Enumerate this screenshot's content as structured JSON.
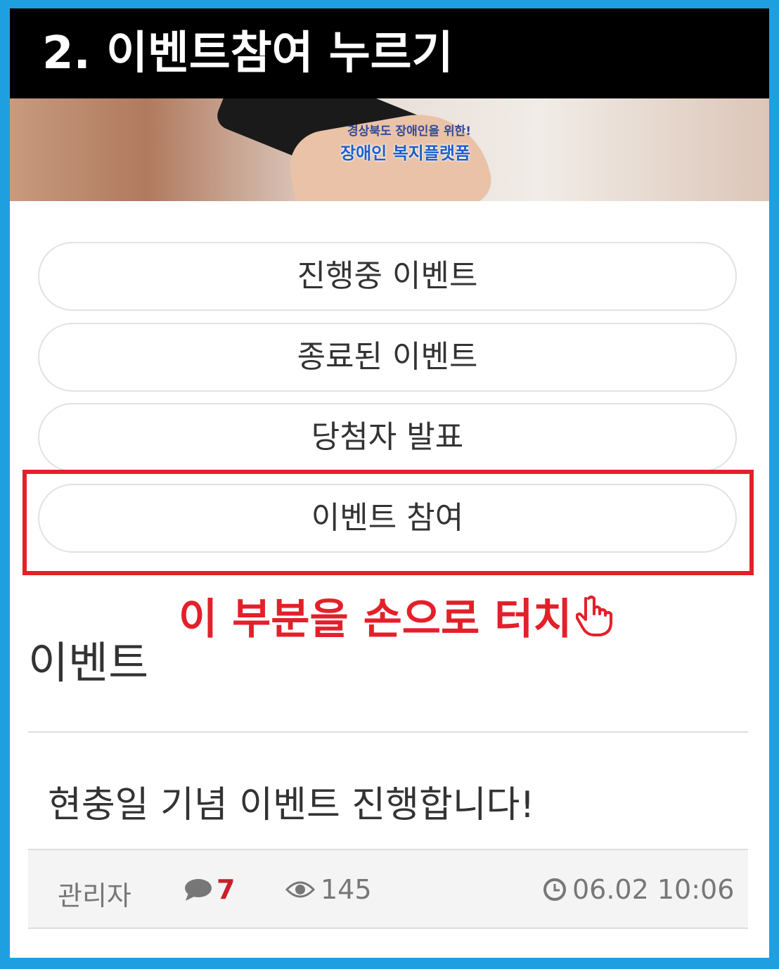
{
  "header": {
    "title": "2. 이벤트참여 누르기"
  },
  "banner": {
    "line1": "경상북도 장애인을 위한!",
    "line2": "장애인 복지플랫폼"
  },
  "menu": {
    "items": [
      {
        "label": "진행중 이벤트"
      },
      {
        "label": "종료된 이벤트"
      },
      {
        "label": "당첨자 발표"
      },
      {
        "label": "이벤트 참여"
      }
    ]
  },
  "annotation": {
    "text": "이 부분을 손으로 터치",
    "color": "#e3202a"
  },
  "section": {
    "title": "이벤트"
  },
  "post": {
    "title": "현충일 기념 이벤트 진행합니다!",
    "author": "관리자",
    "comments": "7",
    "views": "145",
    "datetime": "06.02 10:06"
  },
  "colors": {
    "frame": "#1ea0e0",
    "header_bg": "#000000",
    "accent_red": "#e3202a"
  }
}
